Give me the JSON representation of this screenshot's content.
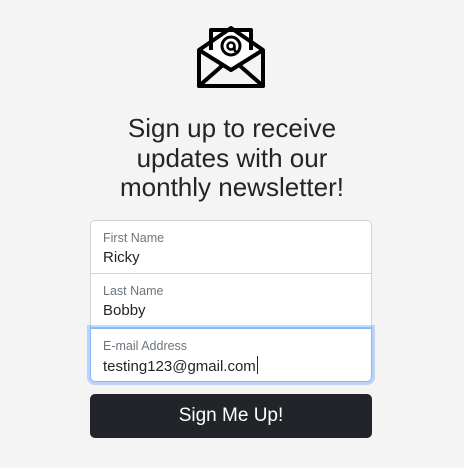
{
  "logo": {
    "icon": "envelope-at-icon"
  },
  "headline": {
    "line1": "Sign up to receive",
    "line2": "updates with our",
    "line3": "monthly newsletter!"
  },
  "form": {
    "first_name": {
      "label": "First Name",
      "value": "Ricky"
    },
    "last_name": {
      "label": "Last Name",
      "value": "Bobby"
    },
    "email": {
      "label": "E-mail Address",
      "value": "testing123@gmail.com"
    },
    "submit_label": "Sign Me Up!"
  },
  "colors": {
    "background": "#f4f4f4",
    "button": "#212529",
    "focus_border": "#86b7fe"
  }
}
